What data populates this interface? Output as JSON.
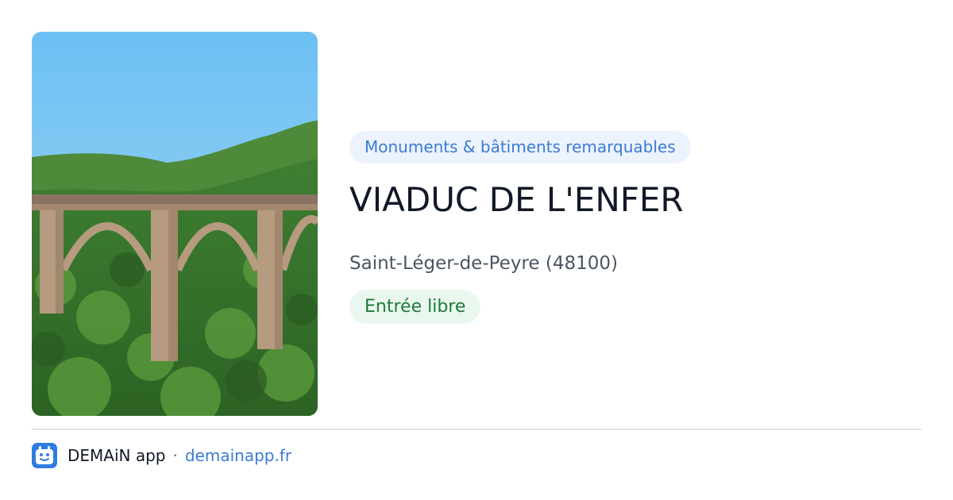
{
  "place": {
    "category": "Monuments & bâtiments remarquables",
    "name": "VIADUC DE L'ENFER",
    "location": "Saint-Léger-de-Peyre (48100)",
    "access": "Entrée libre"
  },
  "footer": {
    "app_name": "DEMAiN app",
    "separator": "·",
    "domain": "demainapp.fr"
  },
  "icons": {
    "app_logo": "demain-app-logo-icon"
  },
  "colors": {
    "category_text": "#3a7bd5",
    "category_bg": "#edf3fd",
    "access_text": "#1e7a3c",
    "access_bg": "#eaf7ee",
    "title": "#111827",
    "link": "#3a7bd5"
  }
}
